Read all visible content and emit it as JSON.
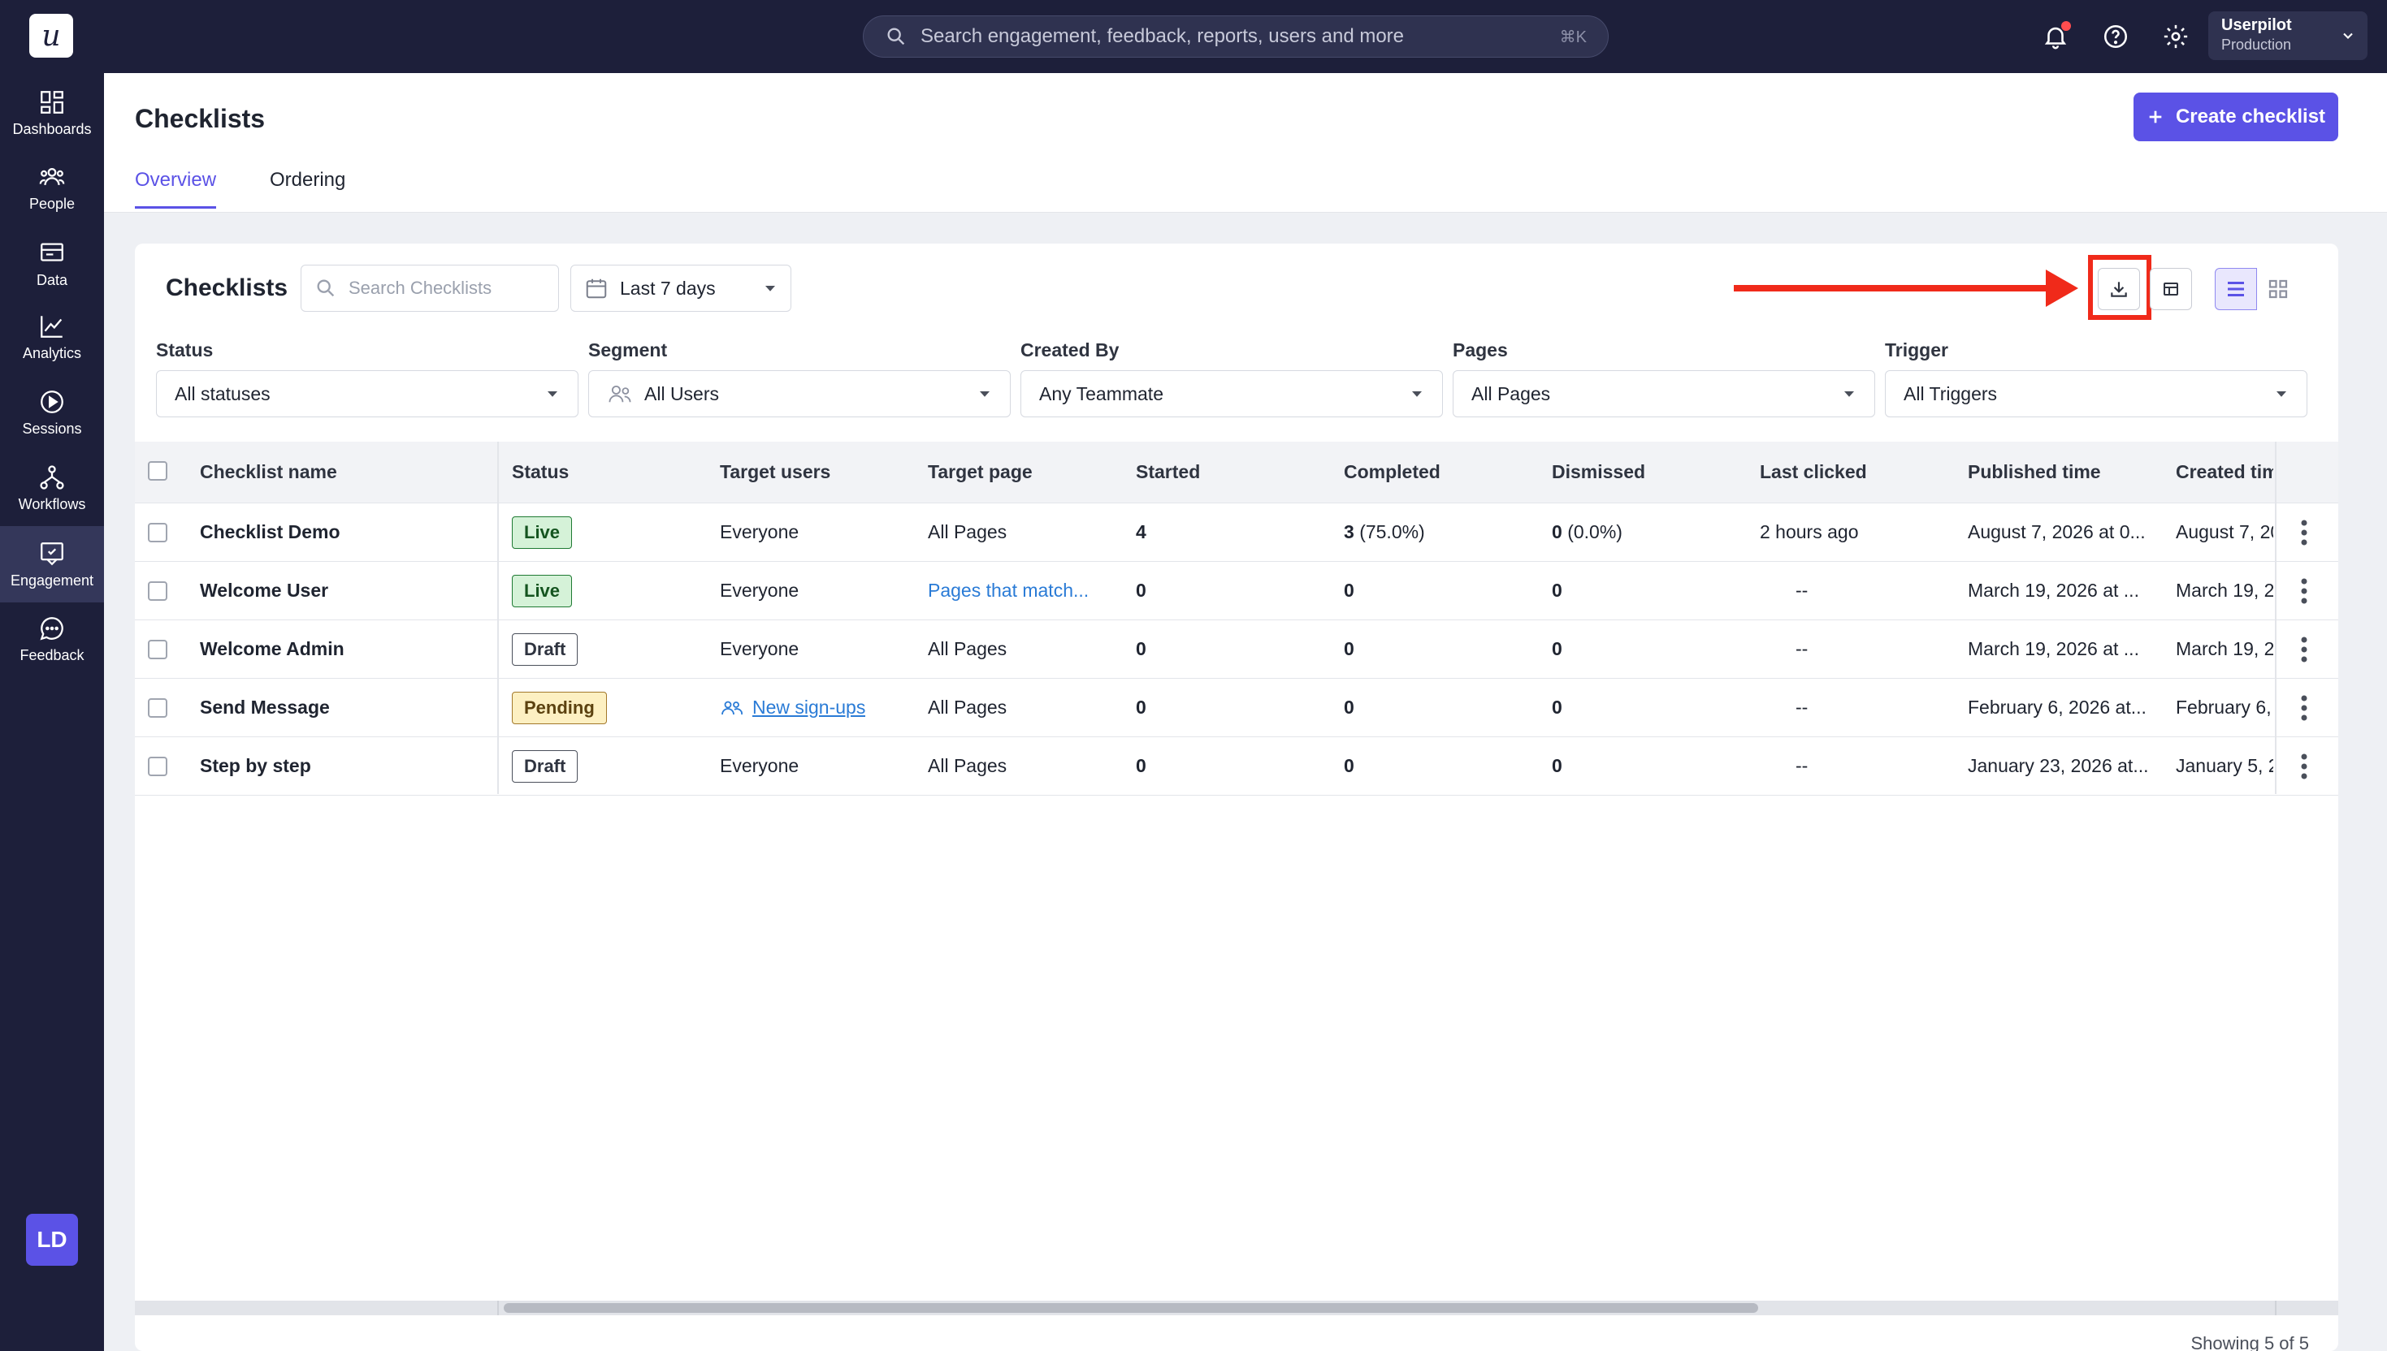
{
  "topbar": {
    "logo": "u",
    "search_placeholder": "Search engagement, feedback, reports, users and more",
    "search_shortcut": "⌘K",
    "account_name": "Userpilot",
    "account_env": "Production"
  },
  "sidebar": {
    "items": [
      {
        "label": "Dashboards",
        "icon": "dashboards-icon"
      },
      {
        "label": "People",
        "icon": "people-icon"
      },
      {
        "label": "Data",
        "icon": "data-icon"
      },
      {
        "label": "Analytics",
        "icon": "analytics-icon"
      },
      {
        "label": "Sessions",
        "icon": "sessions-icon"
      },
      {
        "label": "Workflows",
        "icon": "workflows-icon"
      },
      {
        "label": "Engagement",
        "icon": "engagement-icon",
        "active": true
      },
      {
        "label": "Feedback",
        "icon": "feedback-icon"
      }
    ],
    "avatar": "LD"
  },
  "header": {
    "title": "Checklists",
    "create_label": "Create checklist",
    "tabs": [
      {
        "label": "Overview",
        "active": true
      },
      {
        "label": "Ordering",
        "active": false
      }
    ]
  },
  "card": {
    "title": "Checklists",
    "search_placeholder": "Search Checklists",
    "date_range": "Last 7 days",
    "filters": [
      {
        "label": "Status",
        "value": "All statuses"
      },
      {
        "label": "Segment",
        "value": "All Users"
      },
      {
        "label": "Created By",
        "value": "Any Teammate"
      },
      {
        "label": "Pages",
        "value": "All Pages"
      },
      {
        "label": "Trigger",
        "value": "All Triggers"
      }
    ]
  },
  "table": {
    "columns": [
      "Checklist name",
      "Status",
      "Target users",
      "Target page",
      "Started",
      "Completed",
      "Dismissed",
      "Last clicked",
      "Published time",
      "Created tim"
    ],
    "rows": [
      {
        "name": "Checklist Demo",
        "status": "Live",
        "target_users": "Everyone",
        "target_page": "All Pages",
        "started": "4",
        "completed": "3",
        "completed_pct": "(75.0%)",
        "dismissed": "0",
        "dismissed_pct": "(0.0%)",
        "last_clicked": "2 hours ago",
        "published": "August 7, 2026 at 0...",
        "created": "August 7, 20"
      },
      {
        "name": "Welcome User",
        "status": "Live",
        "target_users": "Everyone",
        "target_page": "Pages that match...",
        "started": "0",
        "completed": "0",
        "completed_pct": "",
        "dismissed": "0",
        "dismissed_pct": "",
        "last_clicked": "--",
        "published": "March 19, 2026 at ...",
        "created": "March 19, 2"
      },
      {
        "name": "Welcome Admin",
        "status": "Draft",
        "target_users": "Everyone",
        "target_page": "All Pages",
        "started": "0",
        "completed": "0",
        "completed_pct": "",
        "dismissed": "0",
        "dismissed_pct": "",
        "last_clicked": "--",
        "published": "March 19, 2026 at ...",
        "created": "March 19, 2"
      },
      {
        "name": "Send Message",
        "status": "Pending",
        "target_users": "New sign-ups",
        "target_page": "All Pages",
        "started": "0",
        "completed": "0",
        "completed_pct": "",
        "dismissed": "0",
        "dismissed_pct": "",
        "last_clicked": "--",
        "published": "February 6, 2026 at...",
        "created": "February 6,"
      },
      {
        "name": "Step by step",
        "status": "Draft",
        "target_users": "Everyone",
        "target_page": "All Pages",
        "started": "0",
        "completed": "0",
        "completed_pct": "",
        "dismissed": "0",
        "dismissed_pct": "",
        "last_clicked": "--",
        "published": "January 23, 2026 at...",
        "created": "January 5, 2"
      }
    ],
    "footer": "Showing 5 of 5"
  },
  "colors": {
    "nav_bg": "#1d1f3a",
    "accent": "#5b52e6",
    "highlight": "#f02a1a",
    "live": "#d5f2d8",
    "pending": "#fdf0c2"
  }
}
